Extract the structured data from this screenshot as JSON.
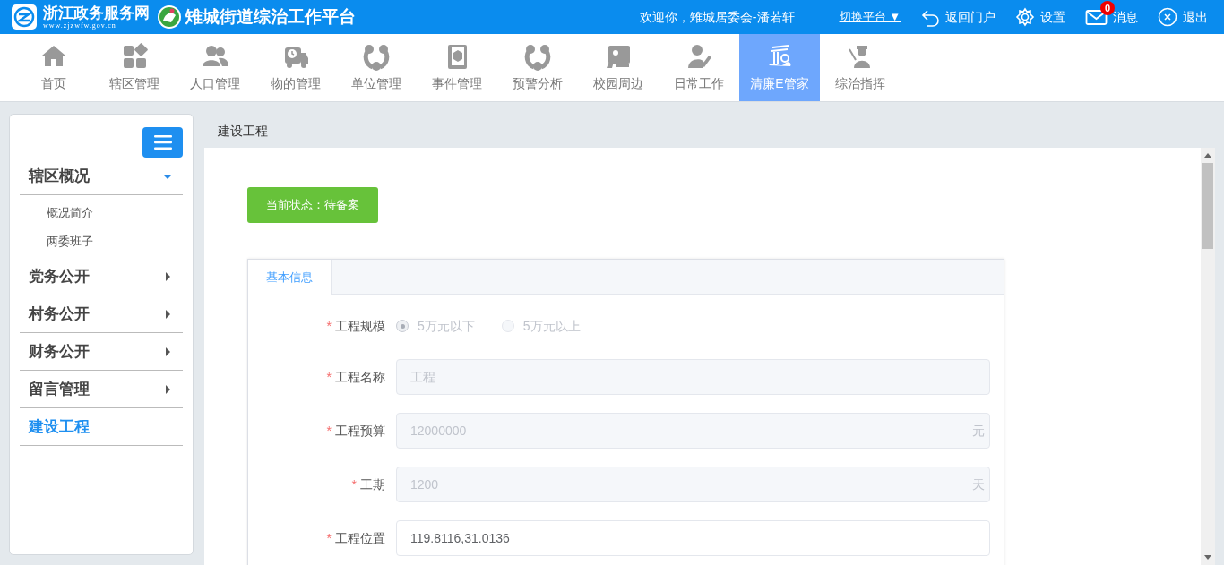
{
  "header": {
    "portal_name": "浙江政务服务网",
    "portal_url": "www.zjzwfw.gov.cn",
    "platform_title": "雉城街道综治工作平台",
    "welcome": "欢迎你，雉城居委会-潘若轩",
    "switch_platform": "切换平台 ▼",
    "actions": [
      {
        "kind": "back",
        "label": "返回门户"
      },
      {
        "kind": "settings",
        "label": "设置"
      },
      {
        "kind": "messages",
        "label": "消息",
        "badge": "0"
      },
      {
        "kind": "logout",
        "label": "退出"
      }
    ]
  },
  "nav": [
    {
      "label": "首页",
      "selected": false
    },
    {
      "label": "辖区管理",
      "selected": false
    },
    {
      "label": "人口管理",
      "selected": false
    },
    {
      "label": "物的管理",
      "selected": false
    },
    {
      "label": "单位管理",
      "selected": false
    },
    {
      "label": "事件管理",
      "selected": false
    },
    {
      "label": "预警分析",
      "selected": false
    },
    {
      "label": "校园周边",
      "selected": false
    },
    {
      "label": "日常工作",
      "selected": false
    },
    {
      "label": "清廉E管家",
      "selected": true
    },
    {
      "label": "综治指挥",
      "selected": false
    }
  ],
  "sidebar": {
    "items": [
      {
        "label": "辖区概况",
        "kind": "group",
        "expanded": true,
        "selected": false,
        "children": [
          {
            "label": "概况简介"
          },
          {
            "label": "两委班子"
          }
        ]
      },
      {
        "label": "党务公开",
        "kind": "group",
        "expanded": false,
        "selected": false
      },
      {
        "label": "村务公开",
        "kind": "group",
        "expanded": false,
        "selected": false
      },
      {
        "label": "财务公开",
        "kind": "group",
        "expanded": false,
        "selected": false
      },
      {
        "label": "留言管理",
        "kind": "group",
        "expanded": false,
        "selected": false
      },
      {
        "label": "建设工程",
        "kind": "link",
        "expanded": false,
        "selected": true
      }
    ]
  },
  "breadcrumb": "建设工程",
  "status_button": "当前状态：待备案",
  "form": {
    "tabs": [
      {
        "label": "基本信息",
        "selected": true
      }
    ],
    "fields": [
      {
        "kind": "radio",
        "label": "工程规模",
        "required_mark": "*",
        "options": [
          {
            "label": "5万元以下",
            "selected": true
          },
          {
            "label": "5万元以上",
            "selected": false
          }
        ]
      },
      {
        "kind": "input",
        "label": "工程名称",
        "required_mark": "*",
        "disabled": true,
        "value": "工程"
      },
      {
        "kind": "input",
        "label": "工程预算",
        "required_mark": "*",
        "disabled": true,
        "value": "12000000",
        "unit": "元"
      },
      {
        "kind": "input",
        "label": "工期",
        "required_mark": "*",
        "disabled": true,
        "value": "1200",
        "unit": "天"
      },
      {
        "kind": "input",
        "label": "工程位置",
        "required_mark": "*",
        "disabled": false,
        "value": "119.8116,31.0136"
      }
    ]
  }
}
